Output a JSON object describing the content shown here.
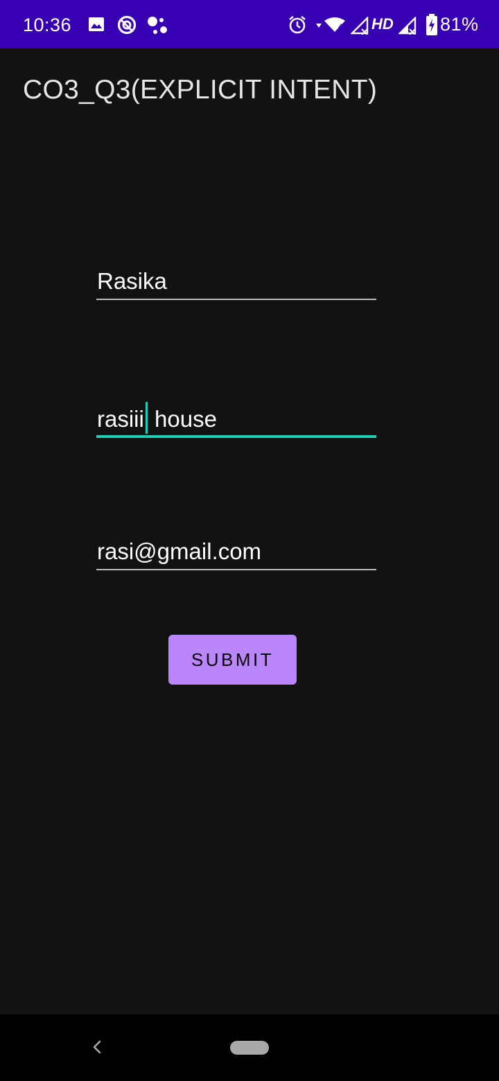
{
  "status_bar": {
    "time": "10:36",
    "hd_label": "HD",
    "battery_percent": "81%",
    "background_color": "#3700b3",
    "icons": [
      "image-icon",
      "data-saver-icon",
      "assistant-dots-icon",
      "alarm-icon",
      "wifi-icon",
      "signal-icon",
      "battery-charging-icon"
    ]
  },
  "app": {
    "title": "CO3_Q3(EXPLICIT INTENT)"
  },
  "form": {
    "name_value": "Rasika",
    "address_value_before_caret": "rasiii",
    "address_value_after_caret": " house",
    "email_value": "rasi@gmail.com",
    "submit_label": "SUBMIT",
    "accent_color": "#1fcfb9",
    "button_color": "#bb86fc"
  },
  "nav_bar": {
    "icons": [
      "back-icon",
      "home-pill-icon"
    ]
  }
}
